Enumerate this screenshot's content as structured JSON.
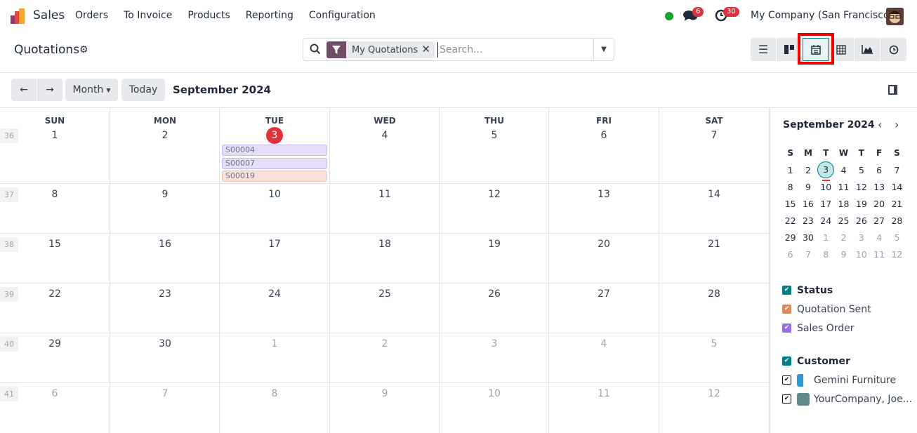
{
  "app": {
    "name": "Sales",
    "menu": [
      "Orders",
      "To Invoice",
      "Products",
      "Reporting",
      "Configuration"
    ]
  },
  "systray": {
    "status_color": "#15a02f",
    "messages_count": "6",
    "activities_count": "30",
    "company": "My Company (San Francisco)"
  },
  "control": {
    "title": "Quotations",
    "search": {
      "facet": "My Quotations",
      "placeholder": "Search..."
    },
    "views": [
      {
        "name": "list",
        "icon": "list-icon"
      },
      {
        "name": "kanban",
        "icon": "kanban-icon"
      },
      {
        "name": "calendar",
        "icon": "calendar-icon",
        "active": true
      },
      {
        "name": "pivot",
        "icon": "table-icon"
      },
      {
        "name": "graph",
        "icon": "area-chart-icon"
      },
      {
        "name": "activity",
        "icon": "clock-icon"
      }
    ]
  },
  "toolbar": {
    "prev": "←",
    "next": "→",
    "scale": "Month",
    "today": "Today",
    "current": "September 2024"
  },
  "calendar": {
    "weekdays": [
      "SUN",
      "MON",
      "TUE",
      "WED",
      "THU",
      "FRI",
      "SAT"
    ],
    "weeks": [
      {
        "num": "36",
        "days": [
          "1",
          "2",
          "3",
          "4",
          "5",
          "6",
          "7"
        ],
        "out": [
          false,
          false,
          false,
          false,
          false,
          false,
          false
        ]
      },
      {
        "num": "37",
        "days": [
          "8",
          "9",
          "10",
          "11",
          "12",
          "13",
          "14"
        ],
        "out": [
          false,
          false,
          false,
          false,
          false,
          false,
          false
        ]
      },
      {
        "num": "38",
        "days": [
          "15",
          "16",
          "17",
          "18",
          "19",
          "20",
          "21"
        ],
        "out": [
          false,
          false,
          false,
          false,
          false,
          false,
          false
        ]
      },
      {
        "num": "39",
        "days": [
          "22",
          "23",
          "24",
          "25",
          "26",
          "27",
          "28"
        ],
        "out": [
          false,
          false,
          false,
          false,
          false,
          false,
          false
        ]
      },
      {
        "num": "40",
        "days": [
          "29",
          "30",
          "1",
          "2",
          "3",
          "4",
          "5"
        ],
        "out": [
          false,
          false,
          true,
          true,
          true,
          true,
          true
        ]
      },
      {
        "num": "41",
        "days": [
          "6",
          "7",
          "8",
          "9",
          "10",
          "11",
          "12"
        ],
        "out": [
          true,
          true,
          true,
          true,
          true,
          true,
          true
        ]
      }
    ],
    "today": "3",
    "events": [
      {
        "label": "S00004",
        "status": "Sales Order",
        "color": "#e7defa"
      },
      {
        "label": "S00007",
        "status": "Sales Order",
        "color": "#e7defa"
      },
      {
        "label": "S00019",
        "status": "Quotation Sent",
        "color": "#f8e2da"
      }
    ]
  },
  "sidebar": {
    "mini_title": "September 2024",
    "mini_headers": [
      "S",
      "M",
      "T",
      "W",
      "T",
      "F",
      "S"
    ],
    "mini_weeks": [
      [
        "1",
        "2",
        "3",
        "4",
        "5",
        "6",
        "7"
      ],
      [
        "8",
        "9",
        "10",
        "11",
        "12",
        "13",
        "14"
      ],
      [
        "15",
        "16",
        "17",
        "18",
        "19",
        "20",
        "21"
      ],
      [
        "22",
        "23",
        "24",
        "25",
        "26",
        "27",
        "28"
      ],
      [
        "29",
        "30",
        "1",
        "2",
        "3",
        "4",
        "5"
      ],
      [
        "6",
        "7",
        "8",
        "9",
        "10",
        "11",
        "12"
      ]
    ],
    "selected": "3",
    "filters": [
      {
        "title": "Status",
        "color": "#017e84",
        "items": [
          {
            "label": "Quotation Sent",
            "color": "#d98b5f"
          },
          {
            "label": "Sales Order",
            "color": "#9b6be6"
          }
        ]
      },
      {
        "title": "Customer",
        "color": "#017e84",
        "items": [
          {
            "label": "Gemini Furniture"
          },
          {
            "label": "YourCompany, Joe..."
          }
        ]
      }
    ]
  }
}
